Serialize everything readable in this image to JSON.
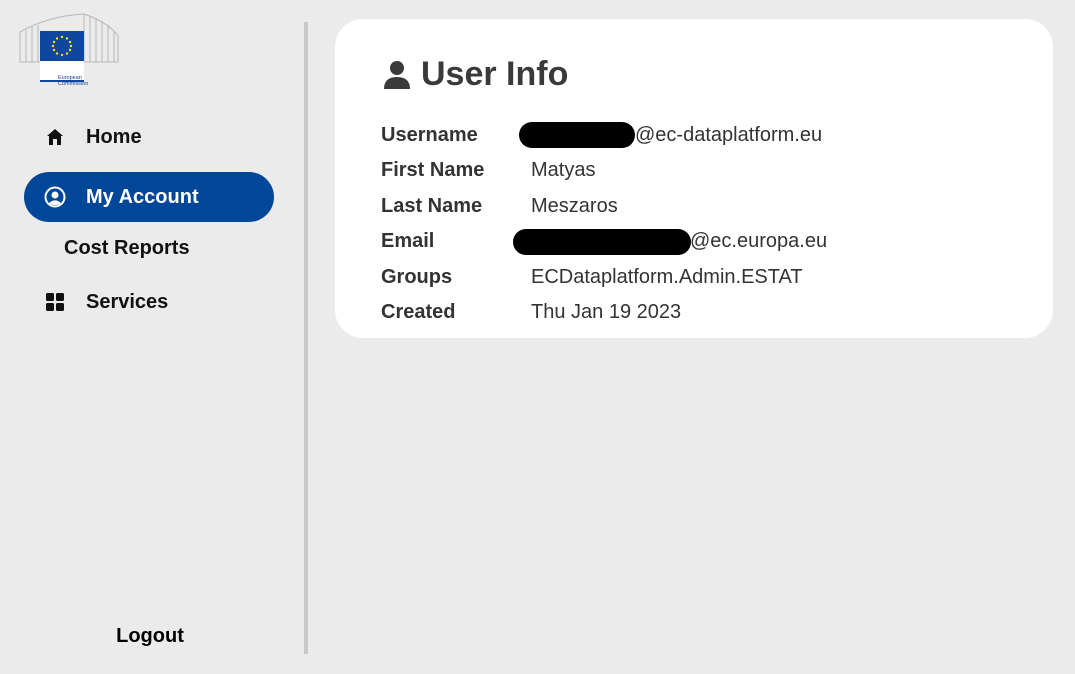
{
  "sidebar": {
    "logo_text_line1": "European",
    "logo_text_line2": "Commission",
    "items": [
      {
        "label": "Home",
        "icon": "home-icon"
      },
      {
        "label": "My Account",
        "icon": "user-circle-icon",
        "active": true
      },
      {
        "label": "Cost Reports"
      },
      {
        "label": "Services",
        "icon": "grid-icon"
      }
    ],
    "logout_label": "Logout"
  },
  "colors": {
    "accent": "#00479a",
    "background": "#ebebeb",
    "card": "#ffffff"
  },
  "card": {
    "title": "User Info",
    "fields": [
      {
        "label": "Username",
        "value": "@ec-dataplatform.eu"
      },
      {
        "label": "First Name",
        "value": "Matyas"
      },
      {
        "label": "Last Name",
        "value": "Meszaros"
      },
      {
        "label": "Email",
        "value": "@ec.europa.eu"
      },
      {
        "label": "Groups",
        "value": "ECDataplatform.Admin.ESTAT"
      },
      {
        "label": "Created",
        "value": "Thu Jan 19 2023"
      }
    ]
  }
}
